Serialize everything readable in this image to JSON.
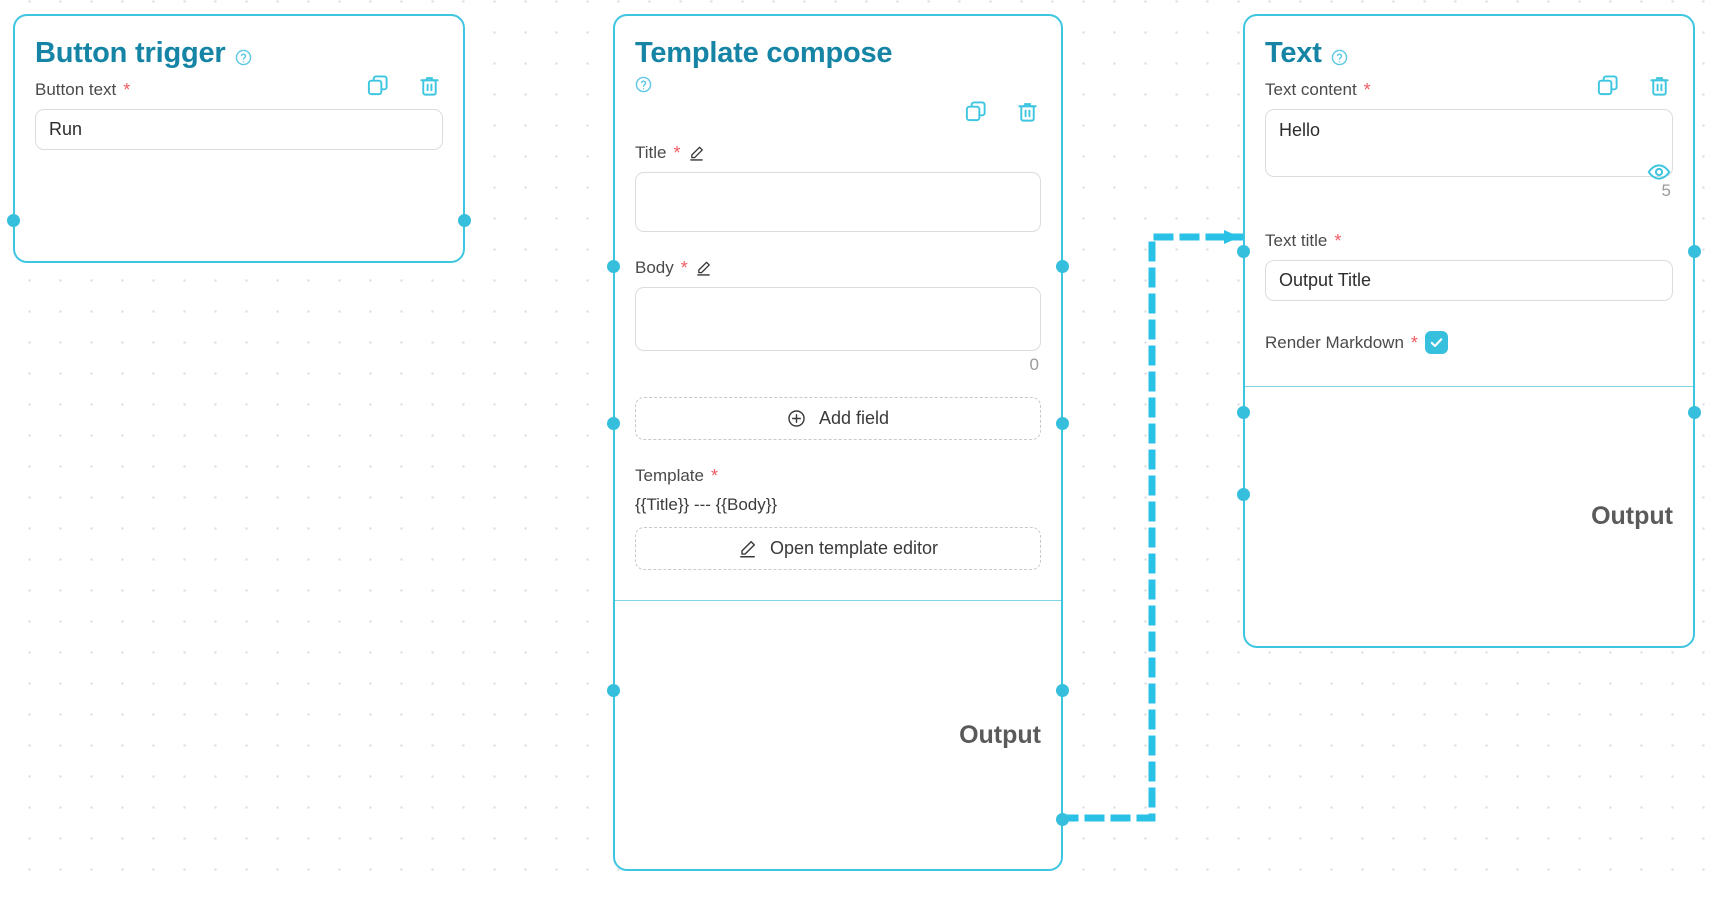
{
  "canvas": {
    "label": "workflow-canvas"
  },
  "nodes": [
    {
      "id": "button-trigger",
      "title": "Button trigger",
      "help_icon": "help-circle-icon",
      "actions": [
        {
          "icon": "copy-icon",
          "label": "Duplicate"
        },
        {
          "icon": "trash-icon",
          "label": "Delete"
        }
      ],
      "fields": [
        {
          "type": "text",
          "label": "Button text",
          "required": "*",
          "value": "Run",
          "placeholder": ""
        }
      ]
    },
    {
      "id": "template-compose",
      "title": "Template compose",
      "help_icon": "help-circle-icon",
      "actions": [
        {
          "icon": "copy-icon",
          "label": "Duplicate"
        },
        {
          "icon": "trash-icon",
          "label": "Delete"
        }
      ],
      "fields": [
        {
          "type": "text",
          "label": "Title",
          "required": "*",
          "edit_icon": "pencil-icon",
          "value": "",
          "placeholder": ""
        },
        {
          "type": "textarea",
          "label": "Body",
          "required": "*",
          "edit_icon": "pencil-icon",
          "value": "",
          "placeholder": "",
          "counter": "0"
        }
      ],
      "add_field_button": {
        "icon": "plus-circle-icon",
        "label": "Add field"
      },
      "template": {
        "label": "Template",
        "required": "*",
        "value": "{{Title}} --- {{Body}}",
        "editor_button": {
          "icon": "pencil-icon",
          "label": "Open template editor"
        }
      },
      "output_label": "Output"
    },
    {
      "id": "text",
      "title": "Text",
      "help_icon": "help-circle-icon",
      "actions": [
        {
          "icon": "copy-icon",
          "label": "Duplicate"
        },
        {
          "icon": "trash-icon",
          "label": "Delete"
        }
      ],
      "preview_icon": "eye-icon",
      "fields": [
        {
          "type": "textarea",
          "label": "Text content",
          "required": "*",
          "value": "Hello",
          "placeholder": "",
          "counter": "5"
        },
        {
          "type": "text",
          "label": "Text title",
          "required": "*",
          "value": "Output Title",
          "placeholder": ""
        },
        {
          "type": "checkbox",
          "label": "Render Markdown",
          "required": "*",
          "checked": true
        }
      ],
      "output_label": "Output"
    }
  ],
  "colors": {
    "node_border": "#3ec6e0",
    "title": "#1584a5",
    "accent": "#36bfdd",
    "required": "#ef5b63",
    "edge": "#29c2e6",
    "grid_dot": "#d8d8dd"
  }
}
